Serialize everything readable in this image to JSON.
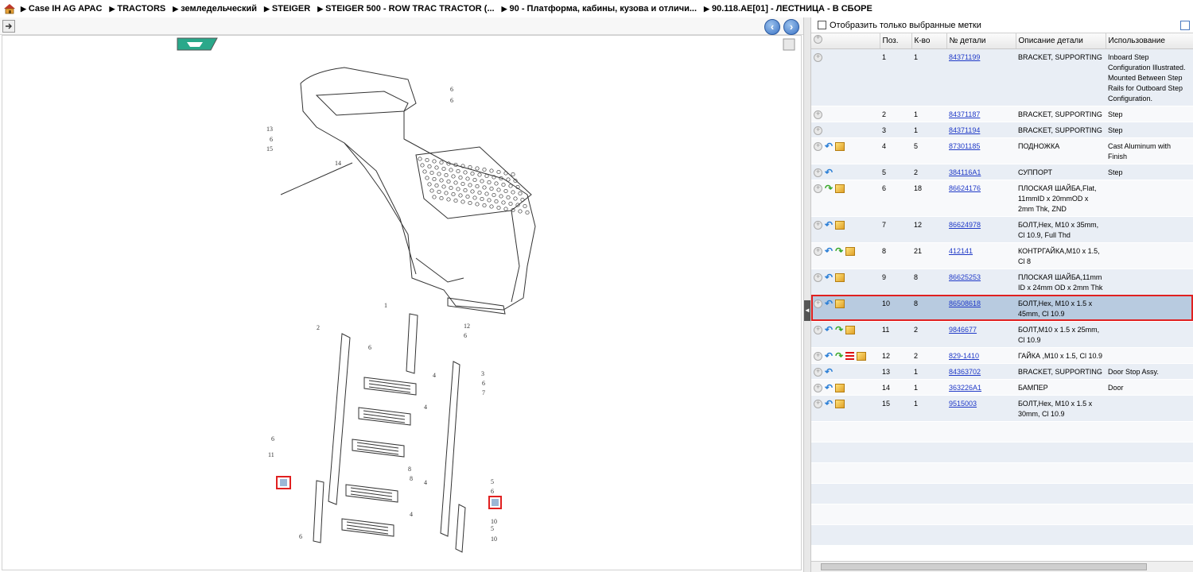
{
  "breadcrumb": [
    "Case IH AG APAC",
    "TRACTORS",
    "земледельческий",
    "STEIGER",
    "STEIGER 500 - ROW TRAC TRACTOR (...",
    "90 - Платформа, кабины, кузова и отличи...",
    "90.118.AE[01] - ЛЕСТНИЦА - В СБОРЕ"
  ],
  "filter": {
    "label": "Отобразить только выбранные метки"
  },
  "columns": [
    "Поз.",
    "К-во",
    "№ детали",
    "Описание детали",
    "Использование"
  ],
  "rows": [
    {
      "pos": "1",
      "qty": "1",
      "part": "84371199",
      "desc": "BRACKET, SUPPORTING",
      "usage": "Inboard Step Configuration Illustrated.  Mounted Between Step Rails for Outboard Step Configuration.",
      "icons": []
    },
    {
      "pos": "2",
      "qty": "1",
      "part": "84371187",
      "desc": "BRACKET, SUPPORTING",
      "usage": "Step",
      "icons": []
    },
    {
      "pos": "3",
      "qty": "1",
      "part": "84371194",
      "desc": "BRACKET, SUPPORTING",
      "usage": "Step",
      "icons": []
    },
    {
      "pos": "4",
      "qty": "5",
      "part": "87301185",
      "desc": "ПОДНОЖКА",
      "usage": "Cast Aluminum with Finish",
      "icons": [
        "back",
        "box"
      ]
    },
    {
      "pos": "5",
      "qty": "2",
      "part": "384116A1",
      "desc": "СУППОРТ",
      "usage": "Step",
      "icons": [
        "back"
      ]
    },
    {
      "pos": "6",
      "qty": "18",
      "part": "86624176",
      "desc": "ПЛОСКАЯ ШАЙБА,Flat, 11mmID x 20mmOD x 2mm Thk, ZND",
      "usage": "",
      "icons": [
        "fwd",
        "box"
      ]
    },
    {
      "pos": "7",
      "qty": "12",
      "part": "86624978",
      "desc": "БОЛТ,Hex, M10 x 35mm, Cl 10.9, Full Thd",
      "usage": "",
      "icons": [
        "back",
        "box"
      ]
    },
    {
      "pos": "8",
      "qty": "21",
      "part": "412141",
      "desc": "КОНТРГАЙКА,M10 x 1.5, Cl 8",
      "usage": "",
      "icons": [
        "back",
        "fwd",
        "box"
      ]
    },
    {
      "pos": "9",
      "qty": "8",
      "part": "86625253",
      "desc": "ПЛОСКАЯ ШАЙБА,11mm ID x 24mm OD x 2mm Thk",
      "usage": "",
      "icons": [
        "back",
        "box"
      ]
    },
    {
      "pos": "10",
      "qty": "8",
      "part": "86508618",
      "desc": "БОЛТ,Hex, M10 x 1.5 x 45mm, Cl 10.9",
      "usage": "",
      "icons": [
        "back",
        "box"
      ],
      "selected": true
    },
    {
      "pos": "11",
      "qty": "2",
      "part": "9846677",
      "desc": "БОЛТ,M10 x 1.5 x 25mm, Cl 10.9",
      "usage": "",
      "icons": [
        "back",
        "fwd",
        "box"
      ]
    },
    {
      "pos": "12",
      "qty": "2",
      "part": "829-1410",
      "desc": "ГАЙКА ,M10 x 1.5, Cl 10.9",
      "usage": "",
      "icons": [
        "back",
        "fwd",
        "flag",
        "box"
      ]
    },
    {
      "pos": "13",
      "qty": "1",
      "part": "84363702",
      "desc": "BRACKET, SUPPORTING",
      "usage": "Door Stop Assy.",
      "icons": [
        "back"
      ]
    },
    {
      "pos": "14",
      "qty": "1",
      "part": "363226A1",
      "desc": "БАМПЕР",
      "usage": "Door",
      "icons": [
        "back",
        "box"
      ]
    },
    {
      "pos": "15",
      "qty": "1",
      "part": "9515003",
      "desc": "БОЛТ,Hex, M10 x 1.5 x 30mm, Cl 10.9",
      "usage": "",
      "icons": [
        "back",
        "box"
      ]
    }
  ],
  "diagram": {
    "callouts": [
      "13",
      "6",
      "15",
      "14",
      "6",
      "6",
      "1",
      "2",
      "6",
      "4",
      "3",
      "6",
      "7",
      "4",
      "6",
      "11",
      "4",
      "8",
      "8",
      "5",
      "6",
      "6",
      "5",
      "4",
      "12",
      "6",
      "10",
      "10"
    ]
  },
  "colors": {
    "link": "#1f39c7",
    "selection_outline": "#e02020",
    "row_selected": "#b8cbe0"
  }
}
